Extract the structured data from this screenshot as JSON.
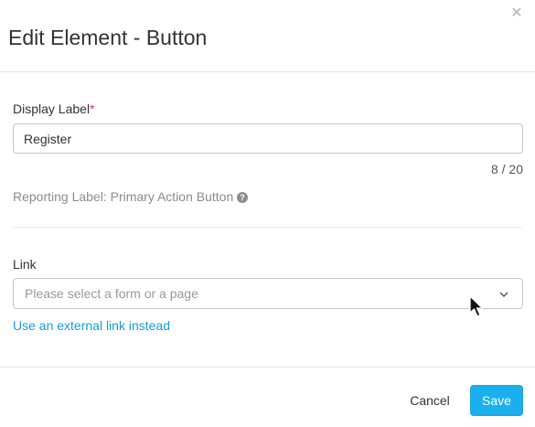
{
  "dialog": {
    "title": "Edit Element - Button",
    "close_icon": "close-icon"
  },
  "display_label": {
    "label": "Display Label",
    "required_marker": "*",
    "value": "Register",
    "char_count": "8 / 20"
  },
  "reporting": {
    "text": "Reporting Label: Primary Action Button",
    "icon": "help-icon"
  },
  "link": {
    "label": "Link",
    "placeholder": "Please select a form or a page",
    "external_link_text": "Use an external link instead"
  },
  "footer": {
    "cancel_label": "Cancel",
    "save_label": "Save"
  },
  "colors": {
    "accent": "#1ab0ef",
    "link": "#1a9ad6",
    "required": "#e0334b"
  }
}
